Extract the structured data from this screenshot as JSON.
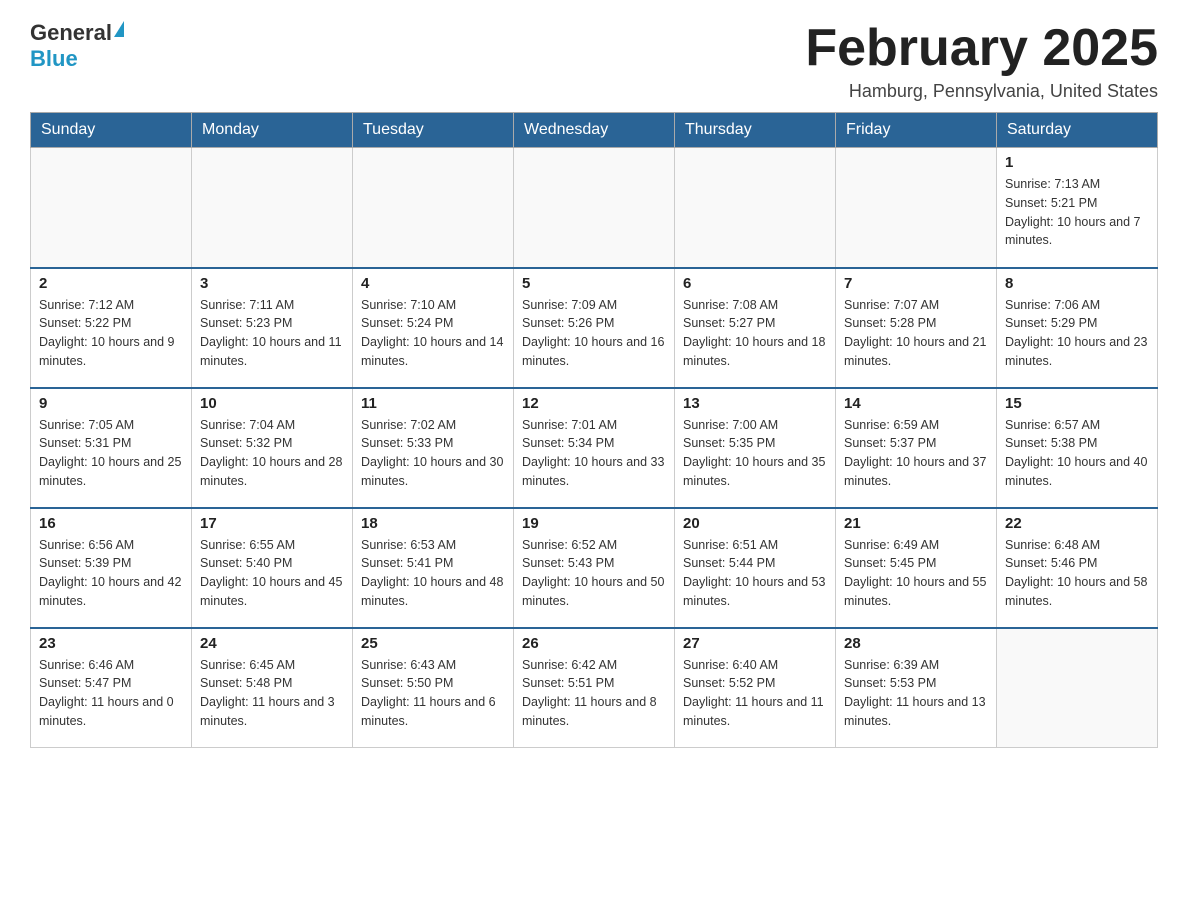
{
  "header": {
    "logo_general": "General",
    "logo_blue": "Blue",
    "month_title": "February 2025",
    "location": "Hamburg, Pennsylvania, United States"
  },
  "days_of_week": [
    "Sunday",
    "Monday",
    "Tuesday",
    "Wednesday",
    "Thursday",
    "Friday",
    "Saturday"
  ],
  "weeks": [
    {
      "days": [
        {
          "num": "",
          "info": ""
        },
        {
          "num": "",
          "info": ""
        },
        {
          "num": "",
          "info": ""
        },
        {
          "num": "",
          "info": ""
        },
        {
          "num": "",
          "info": ""
        },
        {
          "num": "",
          "info": ""
        },
        {
          "num": "1",
          "info": "Sunrise: 7:13 AM\nSunset: 5:21 PM\nDaylight: 10 hours and 7 minutes."
        }
      ]
    },
    {
      "days": [
        {
          "num": "2",
          "info": "Sunrise: 7:12 AM\nSunset: 5:22 PM\nDaylight: 10 hours and 9 minutes."
        },
        {
          "num": "3",
          "info": "Sunrise: 7:11 AM\nSunset: 5:23 PM\nDaylight: 10 hours and 11 minutes."
        },
        {
          "num": "4",
          "info": "Sunrise: 7:10 AM\nSunset: 5:24 PM\nDaylight: 10 hours and 14 minutes."
        },
        {
          "num": "5",
          "info": "Sunrise: 7:09 AM\nSunset: 5:26 PM\nDaylight: 10 hours and 16 minutes."
        },
        {
          "num": "6",
          "info": "Sunrise: 7:08 AM\nSunset: 5:27 PM\nDaylight: 10 hours and 18 minutes."
        },
        {
          "num": "7",
          "info": "Sunrise: 7:07 AM\nSunset: 5:28 PM\nDaylight: 10 hours and 21 minutes."
        },
        {
          "num": "8",
          "info": "Sunrise: 7:06 AM\nSunset: 5:29 PM\nDaylight: 10 hours and 23 minutes."
        }
      ]
    },
    {
      "days": [
        {
          "num": "9",
          "info": "Sunrise: 7:05 AM\nSunset: 5:31 PM\nDaylight: 10 hours and 25 minutes."
        },
        {
          "num": "10",
          "info": "Sunrise: 7:04 AM\nSunset: 5:32 PM\nDaylight: 10 hours and 28 minutes."
        },
        {
          "num": "11",
          "info": "Sunrise: 7:02 AM\nSunset: 5:33 PM\nDaylight: 10 hours and 30 minutes."
        },
        {
          "num": "12",
          "info": "Sunrise: 7:01 AM\nSunset: 5:34 PM\nDaylight: 10 hours and 33 minutes."
        },
        {
          "num": "13",
          "info": "Sunrise: 7:00 AM\nSunset: 5:35 PM\nDaylight: 10 hours and 35 minutes."
        },
        {
          "num": "14",
          "info": "Sunrise: 6:59 AM\nSunset: 5:37 PM\nDaylight: 10 hours and 37 minutes."
        },
        {
          "num": "15",
          "info": "Sunrise: 6:57 AM\nSunset: 5:38 PM\nDaylight: 10 hours and 40 minutes."
        }
      ]
    },
    {
      "days": [
        {
          "num": "16",
          "info": "Sunrise: 6:56 AM\nSunset: 5:39 PM\nDaylight: 10 hours and 42 minutes."
        },
        {
          "num": "17",
          "info": "Sunrise: 6:55 AM\nSunset: 5:40 PM\nDaylight: 10 hours and 45 minutes."
        },
        {
          "num": "18",
          "info": "Sunrise: 6:53 AM\nSunset: 5:41 PM\nDaylight: 10 hours and 48 minutes."
        },
        {
          "num": "19",
          "info": "Sunrise: 6:52 AM\nSunset: 5:43 PM\nDaylight: 10 hours and 50 minutes."
        },
        {
          "num": "20",
          "info": "Sunrise: 6:51 AM\nSunset: 5:44 PM\nDaylight: 10 hours and 53 minutes."
        },
        {
          "num": "21",
          "info": "Sunrise: 6:49 AM\nSunset: 5:45 PM\nDaylight: 10 hours and 55 minutes."
        },
        {
          "num": "22",
          "info": "Sunrise: 6:48 AM\nSunset: 5:46 PM\nDaylight: 10 hours and 58 minutes."
        }
      ]
    },
    {
      "days": [
        {
          "num": "23",
          "info": "Sunrise: 6:46 AM\nSunset: 5:47 PM\nDaylight: 11 hours and 0 minutes."
        },
        {
          "num": "24",
          "info": "Sunrise: 6:45 AM\nSunset: 5:48 PM\nDaylight: 11 hours and 3 minutes."
        },
        {
          "num": "25",
          "info": "Sunrise: 6:43 AM\nSunset: 5:50 PM\nDaylight: 11 hours and 6 minutes."
        },
        {
          "num": "26",
          "info": "Sunrise: 6:42 AM\nSunset: 5:51 PM\nDaylight: 11 hours and 8 minutes."
        },
        {
          "num": "27",
          "info": "Sunrise: 6:40 AM\nSunset: 5:52 PM\nDaylight: 11 hours and 11 minutes."
        },
        {
          "num": "28",
          "info": "Sunrise: 6:39 AM\nSunset: 5:53 PM\nDaylight: 11 hours and 13 minutes."
        },
        {
          "num": "",
          "info": ""
        }
      ]
    }
  ]
}
